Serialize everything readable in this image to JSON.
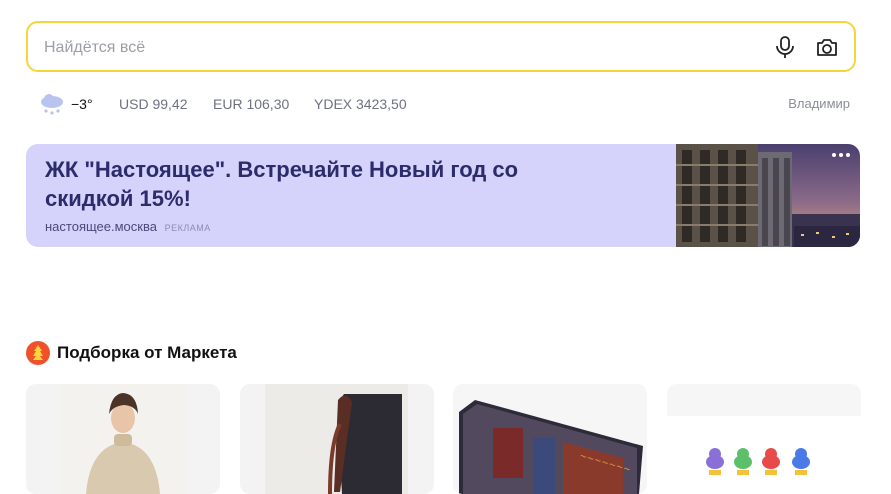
{
  "search": {
    "placeholder": "Найдётся всё"
  },
  "info": {
    "temperature": "−3°",
    "rates": [
      "USD 99,42",
      "EUR 106,30",
      "YDEX 3423,50"
    ],
    "city": "Владимир"
  },
  "ad": {
    "title": "ЖК \"Настоящее\". Встречайте Новый год со скидкой 15%!",
    "domain": "настоящее.москва",
    "tag": "РЕКЛАМА"
  },
  "market": {
    "title": "Подборка от Маркета",
    "cards": [
      {
        "icon": "sweater-product"
      },
      {
        "icon": "bag-product"
      },
      {
        "icon": "board-game-product"
      },
      {
        "icon": "rubber-ducks-product"
      }
    ]
  },
  "colors": {
    "search_border": "#f5d53a",
    "ad_background": "#d5d2fb",
    "ad_title": "#2c2b6b",
    "market_badge": "#f0502a"
  }
}
